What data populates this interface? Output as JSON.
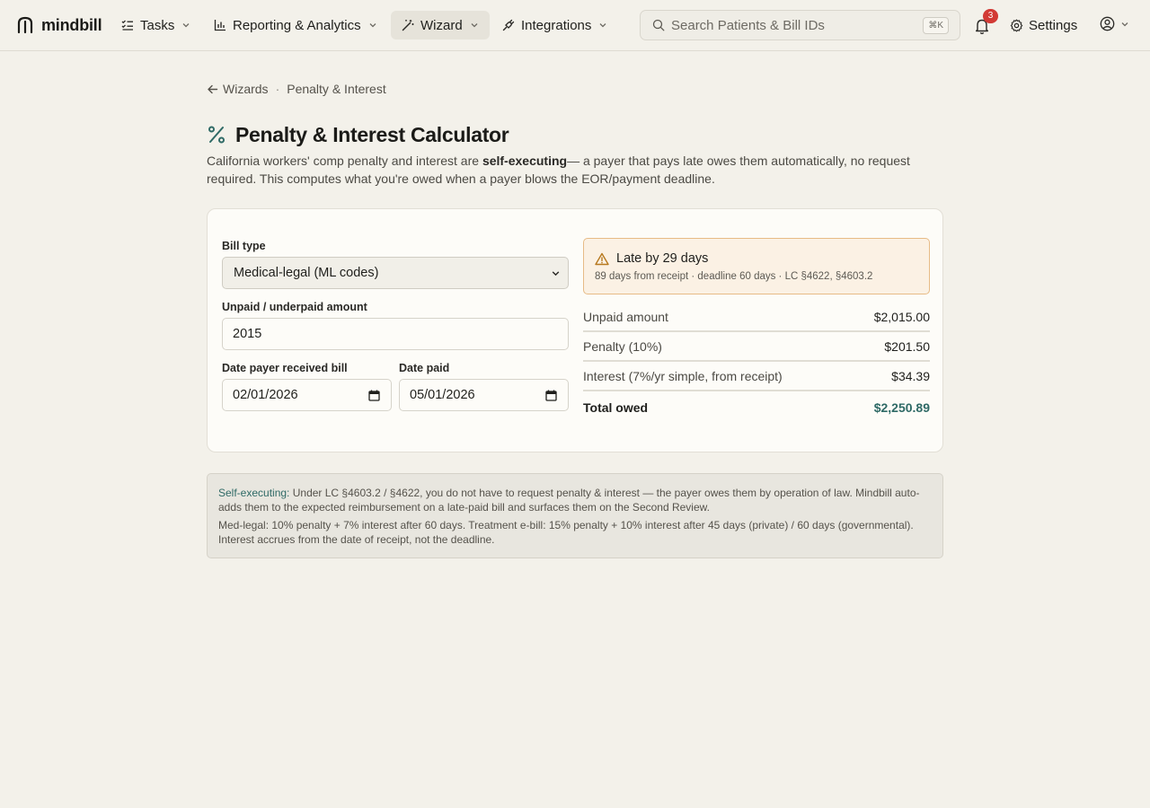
{
  "nav": {
    "brand": "mindbill",
    "items": [
      {
        "label": "Tasks",
        "icon": "list-checks-icon"
      },
      {
        "label": "Reporting & Analytics",
        "icon": "bar-chart-icon"
      },
      {
        "label": "Wizard",
        "icon": "magic-wand-icon"
      },
      {
        "label": "Integrations",
        "icon": "plug-icon"
      }
    ],
    "active": "Wizard",
    "search_placeholder": "Search Patients & Bill IDs",
    "search_shortcut": "⌘K",
    "notifications_count": "3",
    "settings_label": "Settings"
  },
  "breadcrumb": {
    "back": "Wizards",
    "separator": "·",
    "current": "Penalty & Interest"
  },
  "page": {
    "title": "Penalty & Interest Calculator",
    "desc_prefix": "California workers' comp penalty and interest are ",
    "desc_bold": "self-executing",
    "desc_suffix": "— a payer that pays late owes them automatically, no request required. This computes what you're owed when a payer blows the EOR/payment deadline."
  },
  "form": {
    "bill_type_label": "Bill type",
    "bill_type_value": "Medical-legal (ML codes)",
    "amount_label": "Unpaid / underpaid amount",
    "amount_value": "2015",
    "received_label": "Date payer received bill",
    "received_value": "02/01/2026",
    "paid_label": "Date paid",
    "paid_value": "05/01/2026"
  },
  "result": {
    "alert_title": "Late by 29 days",
    "alert_sub": "89 days from receipt · deadline 60 days · LC §4622, §4603.2",
    "rows": [
      {
        "label": "Unpaid amount",
        "value": "$2,015.00"
      },
      {
        "label": "Penalty (10%)",
        "value": "$201.50"
      },
      {
        "label": "Interest (7%/yr simple, from receipt)",
        "value": "$34.39"
      }
    ],
    "total_label": "Total owed",
    "total_value": "$2,250.89"
  },
  "note": {
    "highlight": "Self-executing:",
    "line1": " Under LC §4603.2 / §4622, you do not have to request penalty & interest — the payer owes them by operation of law. Mindbill auto-adds them to the expected reimbursement on a late-paid bill and surfaces them on the Second Review.",
    "line2": "Med-legal: 10% penalty + 7% interest after 60 days. Treatment e-bill: 15% penalty + 10% interest after 45 days (private) / 60 days (governmental). Interest accrues from the date of receipt, not the deadline."
  },
  "colors": {
    "accent": "#2f6a66",
    "warning_border": "#e7bb86",
    "badge": "#d23a35"
  }
}
